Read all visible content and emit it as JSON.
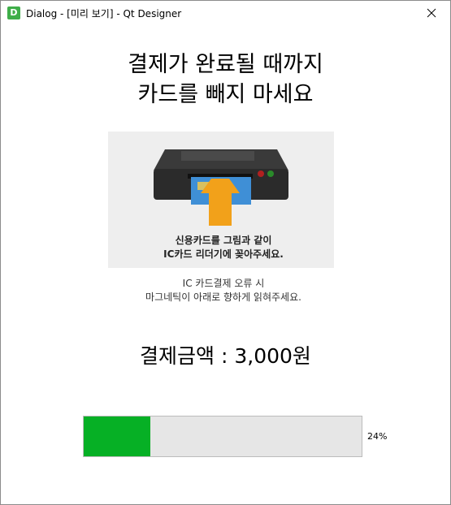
{
  "window": {
    "title": "Dialog - [미리 보기] - Qt Designer",
    "icon_letter": "D",
    "icon_color": "#3fae49"
  },
  "main": {
    "headline_line1": "결제가 완료될 때까지",
    "headline_line2": "카드를 빼지 마세요",
    "guide": {
      "line1": "신용카드를 그림과 같이",
      "line2": "IC카드 리더기에 꽂아주세요.",
      "line3": "IC 카드결제 오류 시",
      "line4": "마그네틱이 아래로 향하게 읽혀주세요."
    },
    "amount_text": "결제금액 : 3,000원"
  },
  "progress": {
    "value": 24,
    "text": "24%",
    "fill_color": "#06b025"
  }
}
